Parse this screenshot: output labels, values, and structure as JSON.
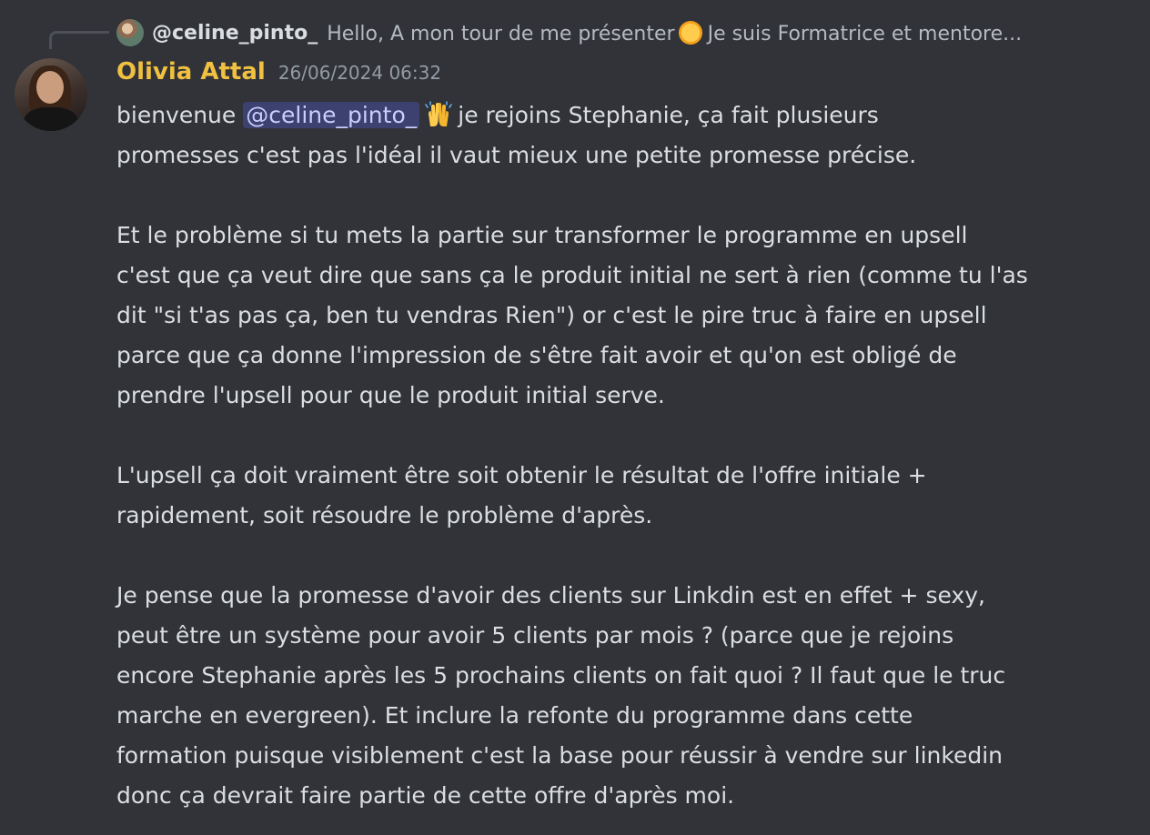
{
  "reply": {
    "author": "@celine_pinto_",
    "text_before_emoji": "Hello, A mon tour de me présenter",
    "emoji": "sun-with-face-icon",
    "text_after_emoji": "Je suis Formatrice et mentore..."
  },
  "message": {
    "author": "Olivia Attal",
    "author_color": "#f0c040",
    "timestamp": "26/06/2024 06:32",
    "line1_prefix": "bienvenue",
    "mention": "@celine_pinto_",
    "line1_emoji": "raising-hands-icon",
    "line1_suffix": "je rejoins Stephanie, ça fait plusieurs",
    "line2": "promesses c'est pas l'idéal il vaut mieux une petite promesse précise.",
    "paragraph2": [
      "Et le problème si tu mets la partie sur transformer le programme en upsell",
      "c'est que ça veut dire que sans ça le produit initial ne sert à rien (comme tu l'as",
      "dit \"si t'as pas ça, ben tu vendras Rien\") or c'est le pire truc à faire en upsell",
      "parce que ça donne l'impression de s'être fait avoir et qu'on est obligé de",
      "prendre l'upsell pour que le produit initial serve."
    ],
    "paragraph3": [
      "L'upsell ça doit vraiment être soit obtenir le résultat de l'offre initiale +",
      "rapidement, soit résoudre le problème d'après."
    ],
    "paragraph4": [
      "Je pense que la promesse d'avoir des clients sur Linkdin est en effet + sexy,",
      "peut être un système pour avoir 5 clients par mois ? (parce que je rejoins",
      "encore Stephanie après les 5 prochains clients on fait quoi ? Il faut que le truc",
      "marche en evergreen). Et inclure la refonte du programme dans cette",
      "formation puisque visiblement c'est la base pour réussir à vendre sur linkedin",
      "donc ça devrait faire partie de cette offre d'après moi."
    ]
  }
}
